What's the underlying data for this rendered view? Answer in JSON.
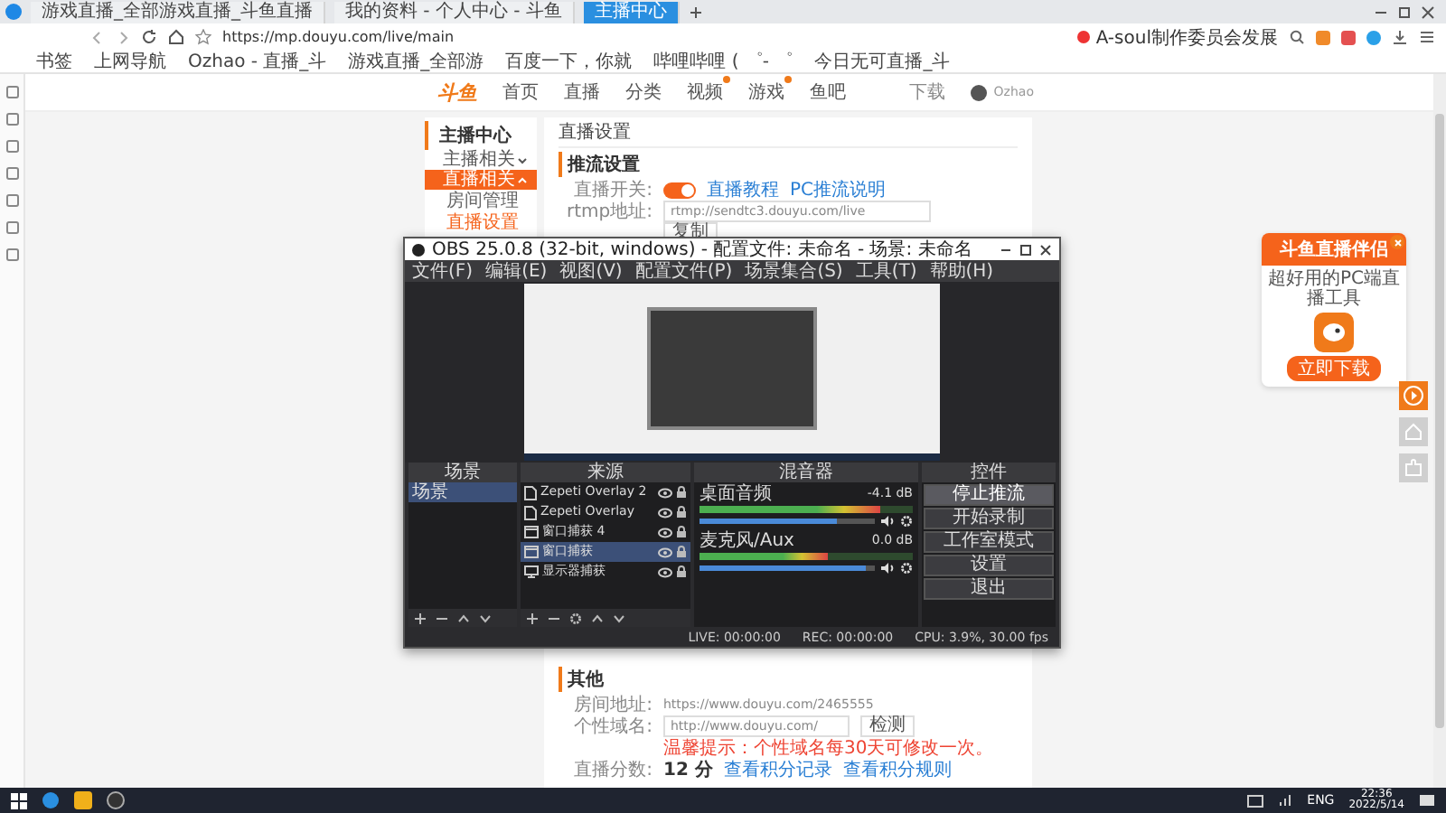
{
  "browser": {
    "tabs": [
      {
        "title": "游戏直播_全部游戏直播_斗鱼直播",
        "selected": false
      },
      {
        "title": "我的资料 - 个人中心 - 斗鱼",
        "selected": false
      },
      {
        "title": "主播中心",
        "selected": true
      }
    ],
    "address": "https://mp.douyu.com/live/main",
    "search": "A-soul制作委员会发展",
    "bookmarks": [
      "书签",
      "上网导航",
      "Ozhao - 直播_斗",
      "游戏直播_全部游",
      "百度一下，你就",
      "哔哩哔哩 ( ゜- ゜",
      "今日无可直播_斗"
    ]
  },
  "site_header": {
    "logo": "斗鱼",
    "nav": [
      {
        "label": "首页",
        "badge": false
      },
      {
        "label": "直播",
        "badge": false
      },
      {
        "label": "分类",
        "badge": false
      },
      {
        "label": "视频",
        "badge": true
      },
      {
        "label": "游戏",
        "badge": true
      },
      {
        "label": "鱼吧",
        "badge": false
      }
    ],
    "download": "下载",
    "user": "Ozhao"
  },
  "sidebar": {
    "title": "主播中心",
    "items": [
      {
        "label": "主播相关",
        "expanded": false,
        "selected": false
      },
      {
        "label": "直播相关",
        "expanded": true,
        "selected": true,
        "children": [
          {
            "label": "房间管理",
            "selected": false
          },
          {
            "label": "直播设置",
            "selected": true
          }
        ]
      }
    ]
  },
  "page": {
    "title": "直播设置",
    "stream": {
      "heading": "推流设置",
      "switch_label": "直播开关:",
      "switch_on": true,
      "links": [
        "直播教程",
        "PC推流说明"
      ],
      "rtmp_label": "rtmp地址:",
      "rtmp_value": "rtmp://sendtc3.douyu.com/live",
      "copy_button": "复制"
    },
    "other": {
      "heading": "其他",
      "room_label": "房间地址:",
      "room_value": "https://www.douyu.com/2465555",
      "domain_label": "个性域名:",
      "domain_prefix": "http://www.douyu.com/",
      "domain_button": "检测",
      "domain_note": "温馨提示：个性域名每30天可修改一次。",
      "score_label": "直播分数:",
      "score_value": "12 分",
      "score_links": [
        "查看积分记录",
        "查看积分规则"
      ]
    }
  },
  "obs": {
    "title": "OBS 25.0.8 (32-bit, windows) - 配置文件: 未命名 - 场景: 未命名",
    "menu": [
      "文件(F)",
      "编辑(E)",
      "视图(V)",
      "配置文件(P)",
      "场景集合(S)",
      "工具(T)",
      "帮助(H)"
    ],
    "docks": [
      "场景",
      "来源",
      "混音器",
      "控件"
    ],
    "scenes": [
      {
        "name": "场景",
        "selected": true
      }
    ],
    "sources": [
      {
        "name": "Zepeti Overlay 2",
        "kind": "image",
        "selected": false
      },
      {
        "name": "Zepeti Overlay",
        "kind": "image",
        "selected": false
      },
      {
        "name": "窗口捕获 4",
        "kind": "window",
        "selected": false
      },
      {
        "name": "窗口捕获",
        "kind": "window",
        "selected": true
      },
      {
        "name": "显示器捕获",
        "kind": "display",
        "selected": false
      }
    ],
    "mixer": [
      {
        "name": "桌面音频",
        "reading": "-4.1 dB",
        "meter": {
          "level": 0.85
        },
        "volume": {
          "level": 0.78
        }
      },
      {
        "name": "麦克风/Aux",
        "reading": "0.0 dB",
        "meter": {
          "level": 0.6
        },
        "volume": {
          "level": 0.95
        }
      }
    ],
    "controls": [
      {
        "label": "停止推流",
        "selected": true
      },
      {
        "label": "开始录制",
        "selected": false
      },
      {
        "label": "工作室模式",
        "selected": false
      },
      {
        "label": "设置",
        "selected": false
      },
      {
        "label": "退出",
        "selected": false
      }
    ],
    "status": [
      "LIVE: 00:00:00",
      "REC: 00:00:00",
      "CPU: 3.9%, 30.00 fps"
    ]
  },
  "promo": {
    "title": "斗鱼直播伴侣",
    "subtitle": "超好用的PC端直播工具",
    "button": "立即下载"
  },
  "taskbar": {
    "language": "ENG",
    "time": "22:36",
    "date": "2022/5/14"
  }
}
